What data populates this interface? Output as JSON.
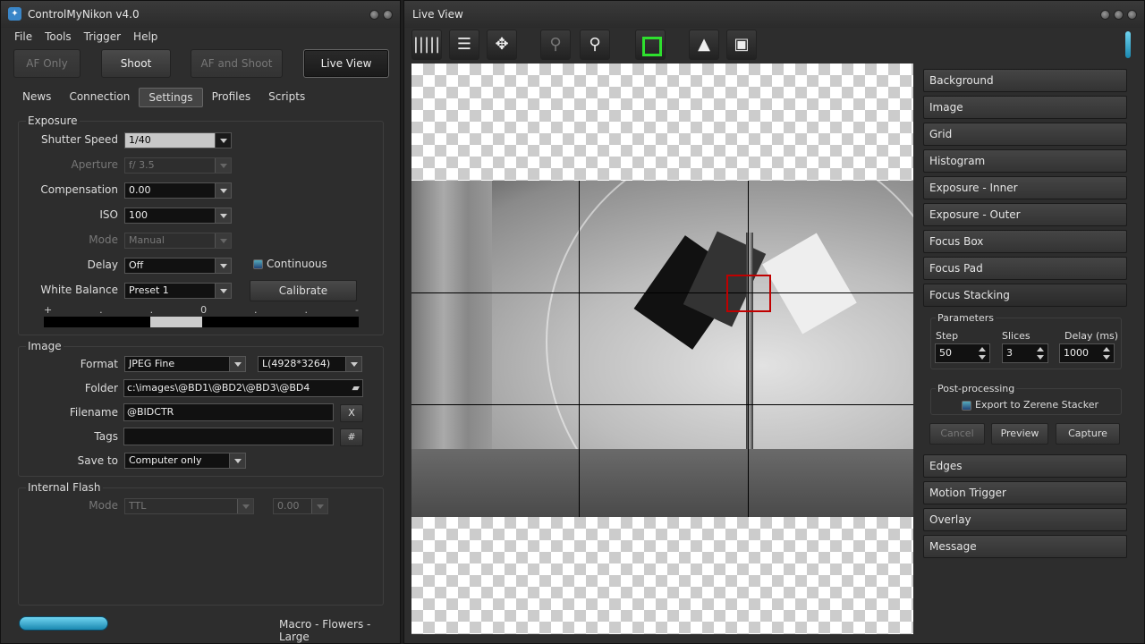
{
  "left_window": {
    "title": "ControlMyNikon v4.0",
    "menu": [
      "File",
      "Tools",
      "Trigger",
      "Help"
    ],
    "buttons": {
      "af_only": "AF Only",
      "shoot": "Shoot",
      "af_and_shoot": "AF and Shoot",
      "live_view": "Live View"
    },
    "tabs": [
      "News",
      "Connection",
      "Settings",
      "Profiles",
      "Scripts"
    ],
    "active_tab": "Settings",
    "exposure": {
      "label": "Exposure",
      "shutter_speed": {
        "label": "Shutter Speed",
        "value": "1/40"
      },
      "aperture": {
        "label": "Aperture",
        "value": "f/ 3.5"
      },
      "compensation": {
        "label": "Compensation",
        "value": "0.00"
      },
      "iso": {
        "label": "ISO",
        "value": "100"
      },
      "mode": {
        "label": "Mode",
        "value": "Manual"
      },
      "delay": {
        "label": "Delay",
        "value": "Off"
      },
      "continuous": "Continuous",
      "white_balance": {
        "label": "White Balance",
        "value": "Preset 1"
      },
      "calibrate": "Calibrate",
      "meter_labels": [
        "+",
        ".",
        ".",
        "0",
        ".",
        ".",
        "-"
      ]
    },
    "image": {
      "label": "Image",
      "format": {
        "label": "Format",
        "value": "JPEG Fine",
        "size": "L(4928*3264)"
      },
      "folder": {
        "label": "Folder",
        "value": "c:\\images\\@BD1\\@BD2\\@BD3\\@BD4"
      },
      "filename": {
        "label": "Filename",
        "value": "@BIDCTR",
        "button": "X"
      },
      "tags": {
        "label": "Tags",
        "value": "",
        "button": "#"
      },
      "save_to": {
        "label": "Save to",
        "value": "Computer only"
      }
    },
    "flash": {
      "label": "Internal Flash",
      "mode": {
        "label": "Mode",
        "value": "TTL",
        "comp": "0.00"
      }
    },
    "status_text": "Macro - Flowers - Large"
  },
  "right_window": {
    "title": "Live View",
    "toolbar": [
      "grid-icon",
      "menu-icon",
      "move-icon",
      "zoom-out-icon",
      "zoom-in-icon",
      "focus-box-icon",
      "portrait-icon",
      "video-icon"
    ],
    "panels_top": [
      "Background",
      "Image",
      "Grid",
      "Histogram",
      "Exposure - Inner",
      "Exposure - Outer",
      "Focus Box",
      "Focus Pad"
    ],
    "focus_stacking": {
      "title": "Focus Stacking",
      "parameters": "Parameters",
      "step": {
        "label": "Step",
        "value": "50"
      },
      "slices": {
        "label": "Slices",
        "value": "3"
      },
      "delay": {
        "label": "Delay (ms)",
        "value": "1000"
      },
      "post_processing": "Post-processing",
      "export": "Export to Zerene Stacker",
      "cancel": "Cancel",
      "preview": "Preview",
      "capture": "Capture"
    },
    "panels_bottom": [
      "Edges",
      "Motion Trigger",
      "Overlay",
      "Message"
    ]
  }
}
